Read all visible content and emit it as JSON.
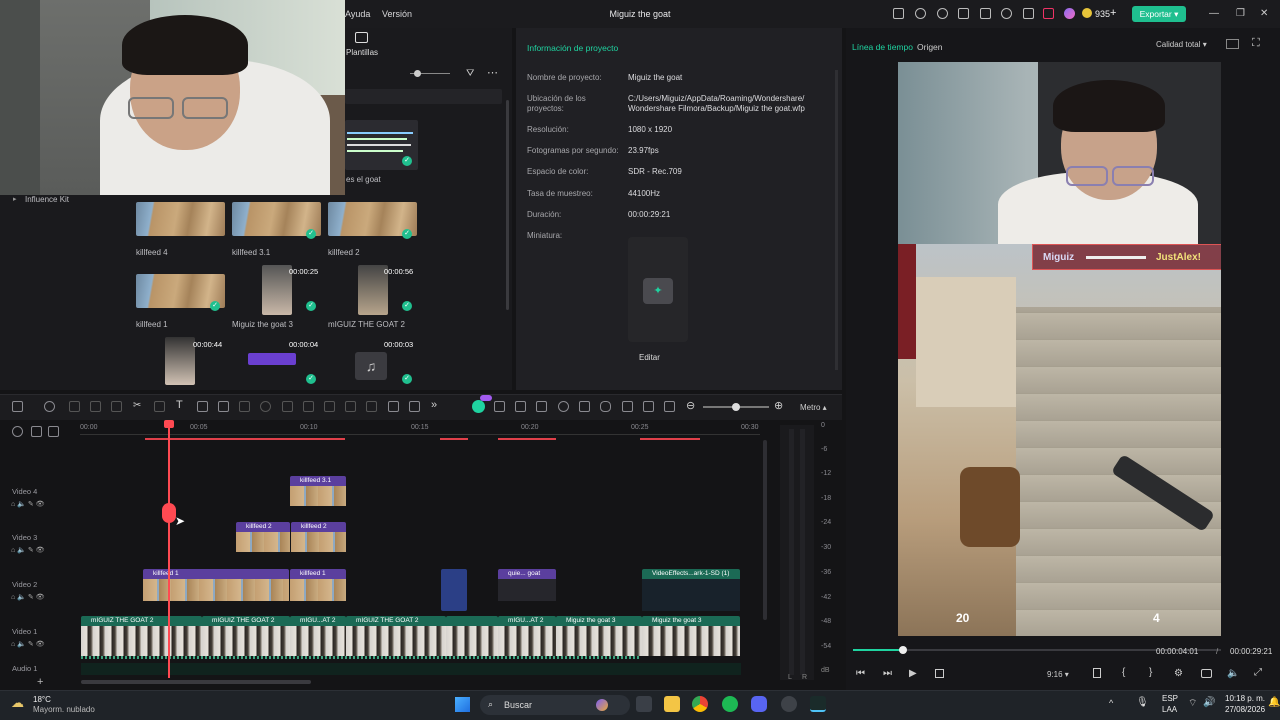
{
  "titlebar": {
    "menu": [
      "Ayuda",
      "Versión"
    ],
    "title": "Miguiz the goat",
    "credits": "935",
    "export": "Exportar"
  },
  "media": {
    "tab": "Plantillas",
    "sidebar_item": "Influence Kit",
    "preview_text": "es el goat",
    "items": [
      {
        "label": "killfeed 4"
      },
      {
        "label": "killfeed 3.1"
      },
      {
        "label": "killfeed 2"
      },
      {
        "label": "killfeed 1"
      },
      {
        "label": "Miguiz the goat 3",
        "duration": "00:00:25"
      },
      {
        "label": "mIGUIZ THE GOAT 2",
        "duration": "00:00:56"
      },
      {
        "label": "",
        "duration": "00:00:44"
      },
      {
        "label": "",
        "duration": "00:00:04"
      },
      {
        "label": "",
        "duration": "00:00:03"
      }
    ]
  },
  "project_info": {
    "title": "Información de proyecto",
    "rows": [
      {
        "label": "Nombre de proyecto:",
        "value": "Miguiz the goat"
      },
      {
        "label": "Ubicación de los proyectos:",
        "value": "C:/Users/Miguiz/AppData/Roaming/Wondershare/ Wondershare Filmora/Backup/Miguiz the goat.wfp"
      },
      {
        "label": "Resolución:",
        "value": "1080 x 1920"
      },
      {
        "label": "Fotogramas por segundo:",
        "value": "23.97fps"
      },
      {
        "label": "Espacio de color:",
        "value": "SDR - Rec.709"
      },
      {
        "label": "Tasa de muestreo:",
        "value": "44100Hz"
      },
      {
        "label": "Duración:",
        "value": "00:00:29:21"
      },
      {
        "label": "Miniatura:",
        "value": ""
      }
    ],
    "edit": "Editar"
  },
  "player": {
    "tab_timeline": "Línea de tiempo",
    "tab_source": "Origen",
    "quality": "Calidad total",
    "killfeed_left": "Miguiz",
    "killfeed_right": "JustAlex!",
    "hud_left": "20",
    "hud_right": "4",
    "current_time": "00:00:04:01",
    "total_time": "00:00:29:21",
    "ratio": "9:16",
    "progress": 0.135
  },
  "timeline": {
    "metro": "Metro",
    "ruler": [
      "00:00",
      "00:05",
      "00:10",
      "00:15",
      "00:20",
      "00:25",
      "00:30"
    ],
    "tracks": [
      "Video 4",
      "Video 3",
      "Video 2",
      "Video 1",
      "Audio 1"
    ],
    "clips": {
      "v4": "killfeed 3.1",
      "v3a": "killfeed 2",
      "v3b": "killfeed 2",
      "v2a": "killfeed 1",
      "v2b": "killfeed 1",
      "v2c": "quie... goat",
      "v2d": "VideoEffects...ark-1-SD (1)",
      "v1": [
        "mIGUIZ THE GOAT 2",
        "mIGUIZ THE GOAT 2",
        "mIGU...AT 2",
        "mIGUIZ THE GOAT 2",
        "mIGU...AT 2",
        "Miguiz the goat 3",
        "Miguiz the goat 3"
      ]
    },
    "meter": [
      "0",
      "-6",
      "-12",
      "-18",
      "-24",
      "-30",
      "-36",
      "-42",
      "-48",
      "-54"
    ],
    "meter_footer": [
      "L",
      "R",
      "dB"
    ]
  },
  "taskbar": {
    "temp": "18°C",
    "weather": "Mayorm. nublado",
    "search": "Buscar",
    "lang1": "ESP",
    "lang2": "LAA",
    "time": "10:18 p. m.",
    "date": "27/08/2026"
  }
}
